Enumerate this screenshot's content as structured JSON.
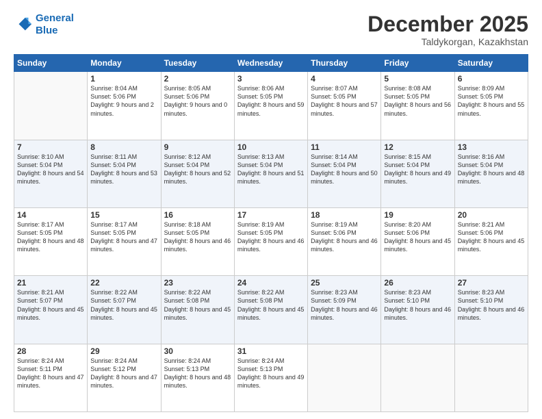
{
  "header": {
    "logo_line1": "General",
    "logo_line2": "Blue",
    "title": "December 2025",
    "subtitle": "Taldykorgan, Kazakhstan"
  },
  "weekdays": [
    "Sunday",
    "Monday",
    "Tuesday",
    "Wednesday",
    "Thursday",
    "Friday",
    "Saturday"
  ],
  "weeks": [
    [
      {
        "day": "",
        "info": ""
      },
      {
        "day": "1",
        "info": "Sunrise: 8:04 AM\nSunset: 5:06 PM\nDaylight: 9 hours\nand 2 minutes."
      },
      {
        "day": "2",
        "info": "Sunrise: 8:05 AM\nSunset: 5:06 PM\nDaylight: 9 hours\nand 0 minutes."
      },
      {
        "day": "3",
        "info": "Sunrise: 8:06 AM\nSunset: 5:05 PM\nDaylight: 8 hours\nand 59 minutes."
      },
      {
        "day": "4",
        "info": "Sunrise: 8:07 AM\nSunset: 5:05 PM\nDaylight: 8 hours\nand 57 minutes."
      },
      {
        "day": "5",
        "info": "Sunrise: 8:08 AM\nSunset: 5:05 PM\nDaylight: 8 hours\nand 56 minutes."
      },
      {
        "day": "6",
        "info": "Sunrise: 8:09 AM\nSunset: 5:05 PM\nDaylight: 8 hours\nand 55 minutes."
      }
    ],
    [
      {
        "day": "7",
        "info": "Sunrise: 8:10 AM\nSunset: 5:04 PM\nDaylight: 8 hours\nand 54 minutes."
      },
      {
        "day": "8",
        "info": "Sunrise: 8:11 AM\nSunset: 5:04 PM\nDaylight: 8 hours\nand 53 minutes."
      },
      {
        "day": "9",
        "info": "Sunrise: 8:12 AM\nSunset: 5:04 PM\nDaylight: 8 hours\nand 52 minutes."
      },
      {
        "day": "10",
        "info": "Sunrise: 8:13 AM\nSunset: 5:04 PM\nDaylight: 8 hours\nand 51 minutes."
      },
      {
        "day": "11",
        "info": "Sunrise: 8:14 AM\nSunset: 5:04 PM\nDaylight: 8 hours\nand 50 minutes."
      },
      {
        "day": "12",
        "info": "Sunrise: 8:15 AM\nSunset: 5:04 PM\nDaylight: 8 hours\nand 49 minutes."
      },
      {
        "day": "13",
        "info": "Sunrise: 8:16 AM\nSunset: 5:04 PM\nDaylight: 8 hours\nand 48 minutes."
      }
    ],
    [
      {
        "day": "14",
        "info": "Sunrise: 8:17 AM\nSunset: 5:05 PM\nDaylight: 8 hours\nand 48 minutes."
      },
      {
        "day": "15",
        "info": "Sunrise: 8:17 AM\nSunset: 5:05 PM\nDaylight: 8 hours\nand 47 minutes."
      },
      {
        "day": "16",
        "info": "Sunrise: 8:18 AM\nSunset: 5:05 PM\nDaylight: 8 hours\nand 46 minutes."
      },
      {
        "day": "17",
        "info": "Sunrise: 8:19 AM\nSunset: 5:05 PM\nDaylight: 8 hours\nand 46 minutes."
      },
      {
        "day": "18",
        "info": "Sunrise: 8:19 AM\nSunset: 5:06 PM\nDaylight: 8 hours\nand 46 minutes."
      },
      {
        "day": "19",
        "info": "Sunrise: 8:20 AM\nSunset: 5:06 PM\nDaylight: 8 hours\nand 45 minutes."
      },
      {
        "day": "20",
        "info": "Sunrise: 8:21 AM\nSunset: 5:06 PM\nDaylight: 8 hours\nand 45 minutes."
      }
    ],
    [
      {
        "day": "21",
        "info": "Sunrise: 8:21 AM\nSunset: 5:07 PM\nDaylight: 8 hours\nand 45 minutes."
      },
      {
        "day": "22",
        "info": "Sunrise: 8:22 AM\nSunset: 5:07 PM\nDaylight: 8 hours\nand 45 minutes."
      },
      {
        "day": "23",
        "info": "Sunrise: 8:22 AM\nSunset: 5:08 PM\nDaylight: 8 hours\nand 45 minutes."
      },
      {
        "day": "24",
        "info": "Sunrise: 8:22 AM\nSunset: 5:08 PM\nDaylight: 8 hours\nand 45 minutes."
      },
      {
        "day": "25",
        "info": "Sunrise: 8:23 AM\nSunset: 5:09 PM\nDaylight: 8 hours\nand 46 minutes."
      },
      {
        "day": "26",
        "info": "Sunrise: 8:23 AM\nSunset: 5:10 PM\nDaylight: 8 hours\nand 46 minutes."
      },
      {
        "day": "27",
        "info": "Sunrise: 8:23 AM\nSunset: 5:10 PM\nDaylight: 8 hours\nand 46 minutes."
      }
    ],
    [
      {
        "day": "28",
        "info": "Sunrise: 8:24 AM\nSunset: 5:11 PM\nDaylight: 8 hours\nand 47 minutes."
      },
      {
        "day": "29",
        "info": "Sunrise: 8:24 AM\nSunset: 5:12 PM\nDaylight: 8 hours\nand 47 minutes."
      },
      {
        "day": "30",
        "info": "Sunrise: 8:24 AM\nSunset: 5:13 PM\nDaylight: 8 hours\nand 48 minutes."
      },
      {
        "day": "31",
        "info": "Sunrise: 8:24 AM\nSunset: 5:13 PM\nDaylight: 8 hours\nand 49 minutes."
      },
      {
        "day": "",
        "info": ""
      },
      {
        "day": "",
        "info": ""
      },
      {
        "day": "",
        "info": ""
      }
    ]
  ]
}
